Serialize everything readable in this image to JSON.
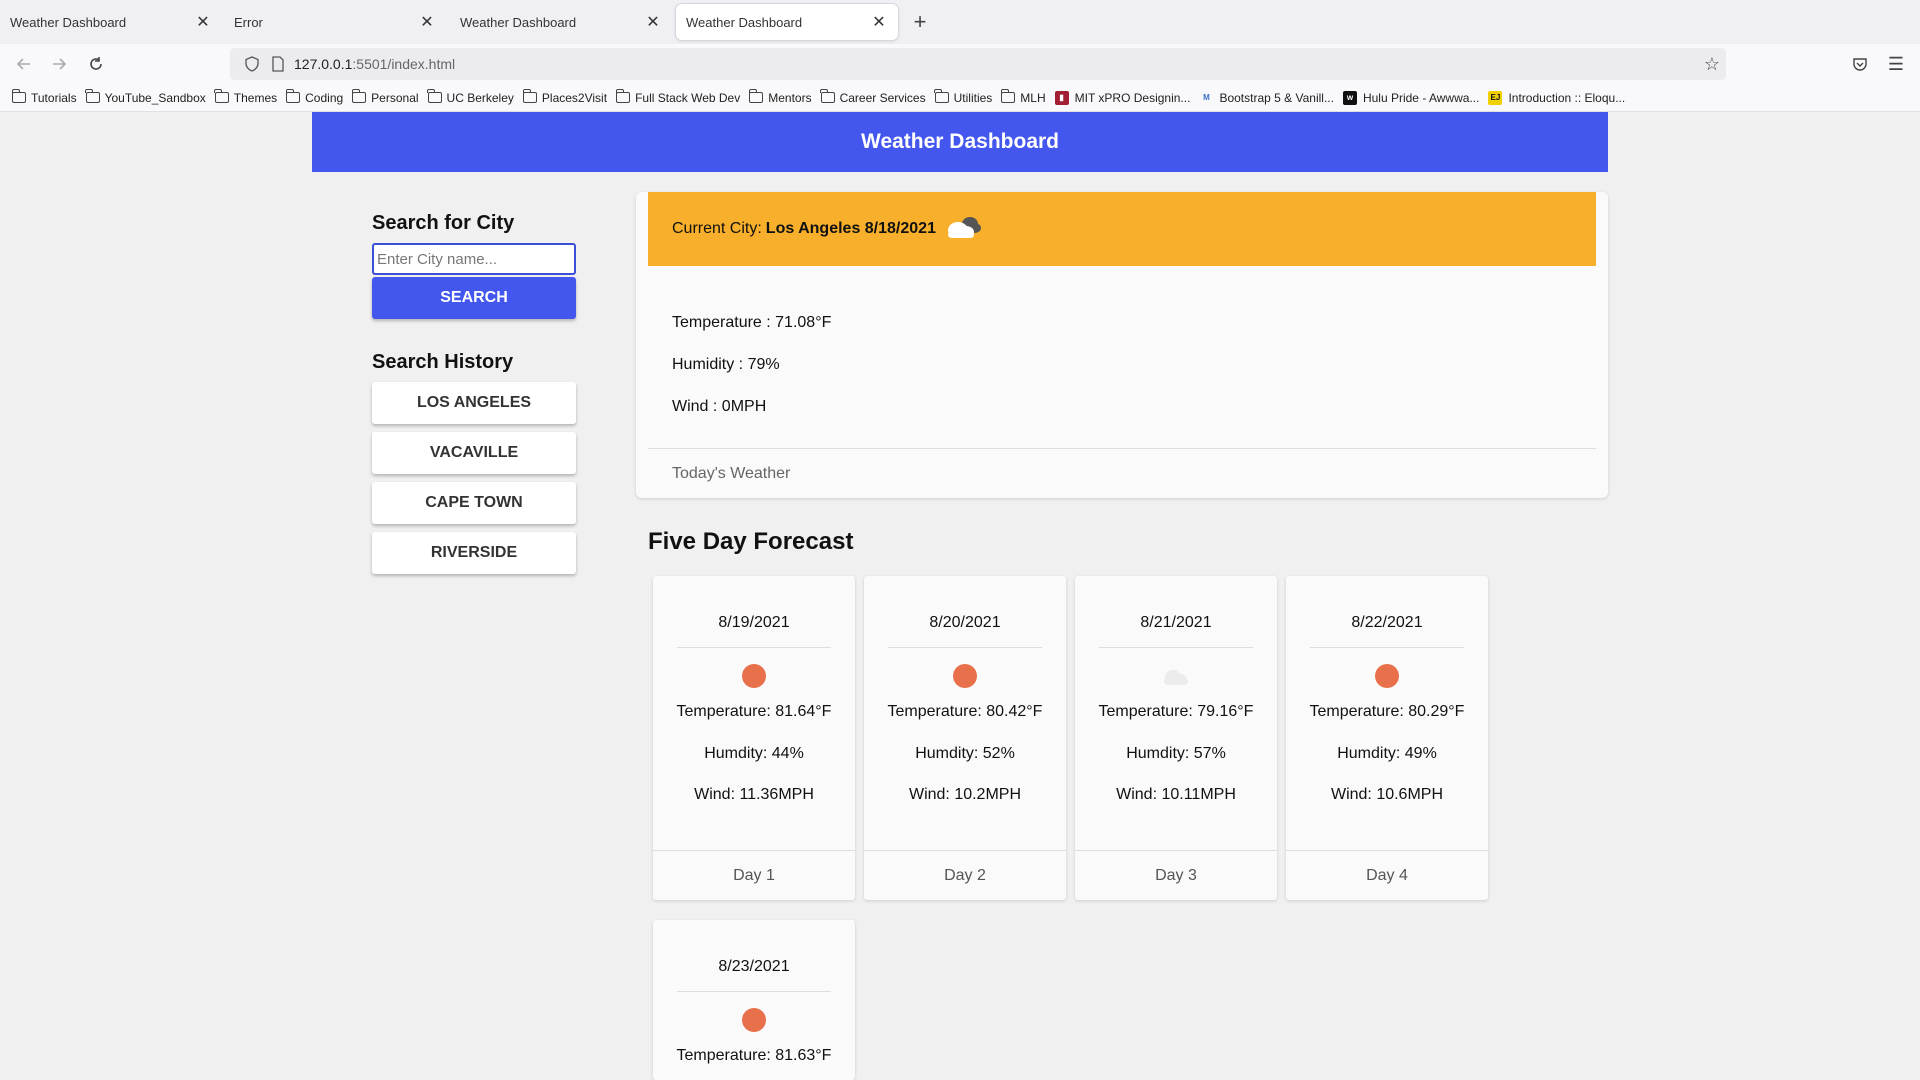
{
  "browser": {
    "tabs": [
      {
        "title": "Weather Dashboard",
        "active": false
      },
      {
        "title": "Error",
        "active": false
      },
      {
        "title": "Weather Dashboard",
        "active": false
      },
      {
        "title": "Weather Dashboard",
        "active": true
      }
    ],
    "url_host": "127.0.0.1",
    "url_path": ":5501/index.html",
    "bookmarks": [
      "Tutorials",
      "YouTube_Sandbox",
      "Themes",
      "Coding",
      "Personal",
      "UC Berkeley",
      "Places2Visit",
      "Full Stack Web Dev",
      "Mentors",
      "Career Services",
      "Utilities",
      "MLH"
    ],
    "bookmarks_sites": [
      {
        "label": "MIT xPRO Designin...",
        "icon": "mit-icon"
      },
      {
        "label": "Bootstrap 5 & Vanill...",
        "icon": "mdb-icon"
      },
      {
        "label": "Hulu Pride - Awwwa...",
        "icon": "awwwards-icon"
      },
      {
        "label": "Introduction :: Eloqu...",
        "icon": "ejs-icon"
      }
    ]
  },
  "header": {
    "title": "Weather Dashboard"
  },
  "sidebar": {
    "search_heading": "Search for City",
    "search_placeholder": "Enter City name...",
    "search_button": "SEARCH",
    "history_heading": "Search History",
    "history": [
      "LOS ANGELES",
      "VACAVILLE",
      "CAPE TOWN",
      "RIVERSIDE"
    ]
  },
  "current": {
    "label": "Current City:",
    "city_date": "Los Angeles 8/18/2021",
    "icon": "cloud-icon",
    "temperature": "Temperature : 71.08°F",
    "humidity": "Humidity : 79%",
    "wind": "Wind : 0MPH",
    "footer": "Today's Weather"
  },
  "forecast": {
    "title": "Five Day Forecast",
    "days": [
      {
        "date": "8/19/2021",
        "icon": "sun-icon",
        "temp": "Temperature: 81.64°F",
        "humidity": "Humdity: 44%",
        "wind": "Wind: 11.36MPH",
        "label": "Day 1"
      },
      {
        "date": "8/20/2021",
        "icon": "sun-icon",
        "temp": "Temperature: 80.42°F",
        "humidity": "Humdity: 52%",
        "wind": "Wind: 10.2MPH",
        "label": "Day 2"
      },
      {
        "date": "8/21/2021",
        "icon": "cloud-icon",
        "temp": "Temperature: 79.16°F",
        "humidity": "Humdity: 57%",
        "wind": "Wind: 10.11MPH",
        "label": "Day 3"
      },
      {
        "date": "8/22/2021",
        "icon": "sun-icon",
        "temp": "Temperature: 80.29°F",
        "humidity": "Humdity: 49%",
        "wind": "Wind: 10.6MPH",
        "label": "Day 4"
      },
      {
        "date": "8/23/2021",
        "icon": "sun-icon",
        "temp": "Temperature: 81.63°F",
        "humidity": "",
        "wind": "",
        "label": ""
      }
    ]
  },
  "colors": {
    "header": "#4356ee",
    "current_head": "#f8b02c",
    "sun": "#e8704a"
  }
}
